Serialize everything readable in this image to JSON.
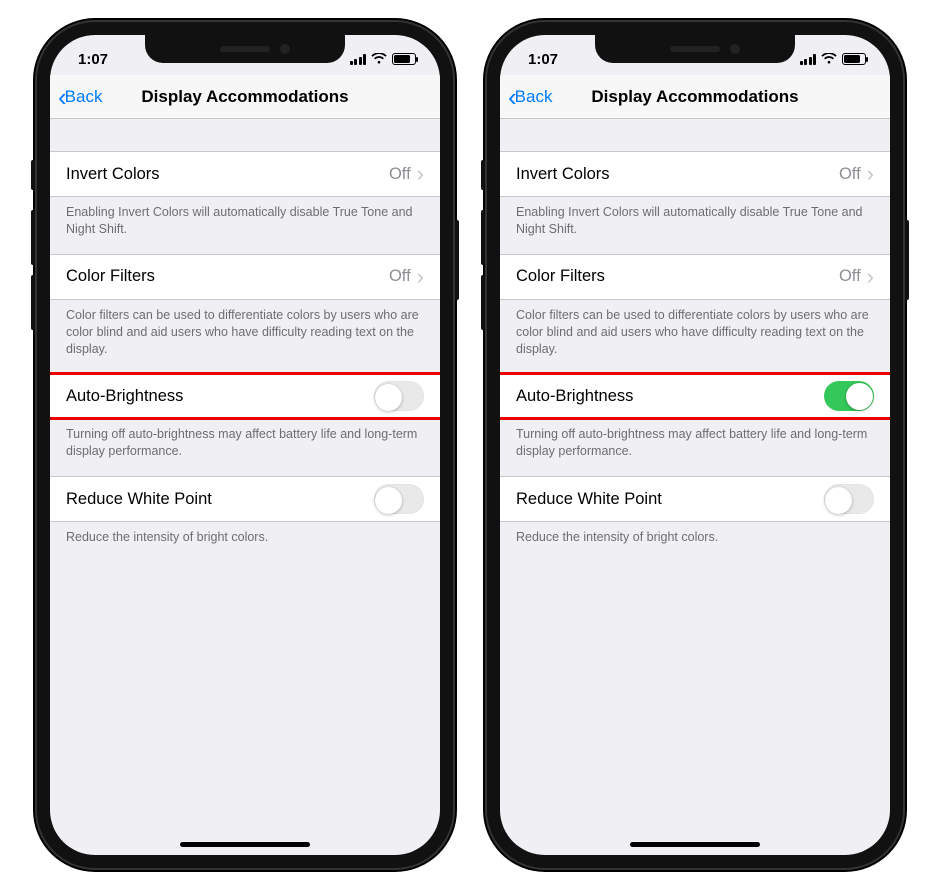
{
  "screens": [
    {
      "status": {
        "time": "1:07"
      },
      "nav": {
        "back": "Back",
        "title": "Display Accommodations"
      },
      "rows": {
        "invert": {
          "label": "Invert Colors",
          "value": "Off"
        },
        "invert_footer": "Enabling Invert Colors will automatically disable True Tone and Night Shift.",
        "filters": {
          "label": "Color Filters",
          "value": "Off"
        },
        "filters_footer": "Color filters can be used to differentiate colors by users who are color blind and aid users who have difficulty reading text on the display.",
        "auto": {
          "label": "Auto-Brightness",
          "on": false
        },
        "auto_footer": "Turning off auto-brightness may affect battery life and long-term display performance.",
        "white": {
          "label": "Reduce White Point",
          "on": false
        },
        "white_footer": "Reduce the intensity of bright colors."
      }
    },
    {
      "status": {
        "time": "1:07"
      },
      "nav": {
        "back": "Back",
        "title": "Display Accommodations"
      },
      "rows": {
        "invert": {
          "label": "Invert Colors",
          "value": "Off"
        },
        "invert_footer": "Enabling Invert Colors will automatically disable True Tone and Night Shift.",
        "filters": {
          "label": "Color Filters",
          "value": "Off"
        },
        "filters_footer": "Color filters can be used to differentiate colors by users who are color blind and aid users who have difficulty reading text on the display.",
        "auto": {
          "label": "Auto-Brightness",
          "on": true
        },
        "auto_footer": "Turning off auto-brightness may affect battery life and long-term display performance.",
        "white": {
          "label": "Reduce White Point",
          "on": false
        },
        "white_footer": "Reduce the intensity of bright colors."
      }
    }
  ]
}
